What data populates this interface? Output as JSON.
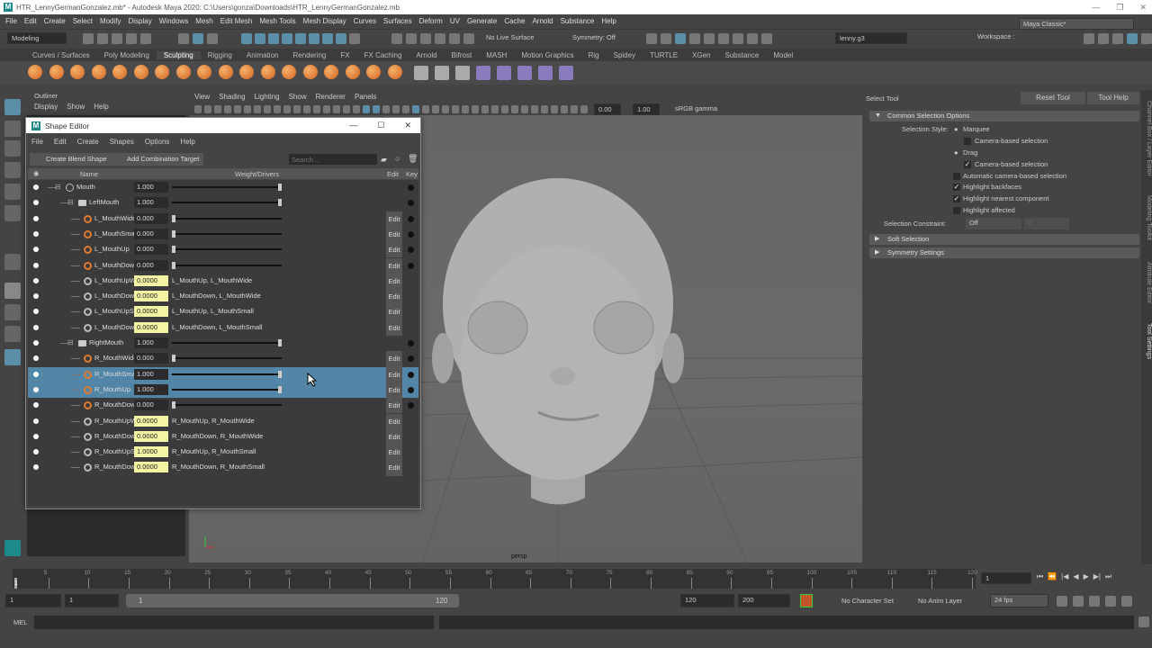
{
  "title": "HTR_LennyGermanGonzalez.mb* - Autodesk Maya 2020: C:\\Users\\gonza\\Downloads\\HTR_LennyGermanGonzalez.mb",
  "menus": [
    "File",
    "Edit",
    "Create",
    "Select",
    "Modify",
    "Display",
    "Windows",
    "Mesh",
    "Edit Mesh",
    "Mesh Tools",
    "Mesh Display",
    "Curves",
    "Surfaces",
    "Deform",
    "UV",
    "Generate",
    "Cache",
    "Arnold",
    "Substance",
    "Help"
  ],
  "workspace": {
    "label": "Workspace :",
    "value": "Maya Classic*"
  },
  "status": {
    "mode": "Modeling",
    "live_surface": "No Live Surface",
    "symmetry": "Symmetry: Off",
    "user": "lenny.g3"
  },
  "shelf_tabs": [
    "Curves / Surfaces",
    "Poly Modeling",
    "Sculpting",
    "Rigging",
    "Animation",
    "Rendering",
    "FX",
    "FX Caching",
    "Arnold",
    "Bifrost",
    "MASH",
    "Motion Graphics",
    "Rig",
    "Spidey",
    "TURTLE",
    "XGen",
    "Substance",
    "Model"
  ],
  "shelf_active": "Sculpting",
  "outliner": {
    "title": "Outliner",
    "menus": [
      "Display",
      "Show",
      "Help"
    ]
  },
  "viewport": {
    "menus": [
      "View",
      "Shading",
      "Lighting",
      "Show",
      "Renderer",
      "Panels"
    ],
    "exposure": "0.00",
    "gamma": "1.00",
    "color_space": "sRGB gamma",
    "camera": "persp"
  },
  "shape_editor": {
    "title": "Shape Editor",
    "menus": [
      "File",
      "Edit",
      "Create",
      "Shapes",
      "Options",
      "Help"
    ],
    "create_blend_shape": "Create Blend Shape",
    "add_combination": "Add Combination Target",
    "search_placeholder": "Search...",
    "columns": {
      "name": "Name",
      "weight": "Weight/Drivers",
      "edit": "Edit",
      "key": "Key"
    },
    "rows": [
      {
        "name": "Mouth",
        "value": "1.000",
        "kind": "slider",
        "weight": 1,
        "level": 0,
        "icon": "blendshape",
        "key": true
      },
      {
        "name": "LeftMouth",
        "value": "1.000",
        "kind": "slider",
        "weight": 1,
        "level": 1,
        "icon": "folder",
        "key": true
      },
      {
        "name": "L_MouthWide",
        "value": "0.000",
        "kind": "slider",
        "weight": 0,
        "level": 2,
        "icon": "target",
        "edit": "Edit",
        "key": true
      },
      {
        "name": "L_MouthSmall",
        "value": "0.000",
        "kind": "slider",
        "weight": 0,
        "level": 2,
        "icon": "target",
        "edit": "Edit",
        "key": true
      },
      {
        "name": "L_MouthUp",
        "value": "0.000",
        "kind": "slider",
        "weight": 0,
        "level": 2,
        "icon": "target",
        "edit": "Edit",
        "key": true
      },
      {
        "name": "L_MouthDown",
        "value": "0.000",
        "kind": "slider",
        "weight": 0,
        "level": 2,
        "icon": "target",
        "edit": "Edit",
        "key": true
      },
      {
        "name": "L_MouthUpWide",
        "value": "0.0000",
        "kind": "combo",
        "drivers": "L_MouthUp, L_MouthWide",
        "level": 2,
        "icon": "combo",
        "edit": "Edit"
      },
      {
        "name": "L_MouthDownWide",
        "value": "0.0000",
        "kind": "combo",
        "drivers": "L_MouthDown, L_MouthWide",
        "level": 2,
        "icon": "combo",
        "edit": "Edit"
      },
      {
        "name": "L_MouthUpSmall",
        "value": "0.0000",
        "kind": "combo",
        "drivers": "L_MouthUp, L_MouthSmall",
        "level": 2,
        "icon": "combo",
        "edit": "Edit"
      },
      {
        "name": "L_MouthDownSmall",
        "value": "0.0000",
        "kind": "combo",
        "drivers": "L_MouthDown, L_MouthSmall",
        "level": 2,
        "icon": "combo",
        "edit": "Edit"
      },
      {
        "name": "RightMouth",
        "value": "1.000",
        "kind": "slider",
        "weight": 1,
        "level": 1,
        "icon": "folder",
        "key": true
      },
      {
        "name": "R_MouthWide",
        "value": "0.000",
        "kind": "slider",
        "weight": 0,
        "level": 2,
        "icon": "target",
        "edit": "Edit",
        "key": true
      },
      {
        "name": "R_MouthSmall",
        "value": "1.000",
        "kind": "slider",
        "weight": 1,
        "level": 2,
        "icon": "target",
        "edit": "Edit",
        "key": true,
        "selected": true
      },
      {
        "name": "R_MouthUp",
        "value": "1.000",
        "kind": "slider",
        "weight": 1,
        "level": 2,
        "icon": "target",
        "edit": "Edit",
        "key": true,
        "selected": true
      },
      {
        "name": "R_MouthDown",
        "value": "0.000",
        "kind": "slider",
        "weight": 0,
        "level": 2,
        "icon": "target",
        "edit": "Edit",
        "key": true
      },
      {
        "name": "R_MouthUpWide",
        "value": "0.0000",
        "kind": "combo",
        "drivers": "R_MouthUp, R_MouthWide",
        "level": 2,
        "icon": "combo",
        "edit": "Edit"
      },
      {
        "name": "R_MouthDownWide",
        "value": "0.0000",
        "kind": "combo",
        "drivers": "R_MouthDown, R_MouthWide",
        "level": 2,
        "icon": "combo",
        "edit": "Edit"
      },
      {
        "name": "R_MouthUpSmall",
        "value": "1.0000",
        "kind": "combo",
        "drivers": "R_MouthUp, R_MouthSmall",
        "level": 2,
        "icon": "combo",
        "edit": "Edit"
      },
      {
        "name": "R_MouthDownSmall",
        "value": "0.0000",
        "kind": "combo",
        "drivers": "R_MouthDown, R_MouthSmall",
        "level": 2,
        "icon": "combo",
        "edit": "Edit"
      }
    ]
  },
  "tool_settings": {
    "title": "Select Tool",
    "reset": "Reset Tool",
    "help": "Tool Help",
    "section_common": "Common Selection Options",
    "selection_style_label": "Selection Style:",
    "marquee": "Marquee",
    "camera_based_1": "Camera-based selection",
    "drag": "Drag",
    "camera_based_2": "Camera-based selection",
    "auto_camera": "Automatic camera-based selection",
    "highlight_backfaces": "Highlight backfaces",
    "highlight_nearest": "Highlight nearest component",
    "highlight_affected": "Highlight affected",
    "constraint_label": "Selection Constraint:",
    "constraint_value": "Off",
    "constraint_num": "0",
    "section_soft": "Soft Selection",
    "section_symmetry": "Symmetry Settings"
  },
  "side_tabs": [
    "Channel Box / Layer Editor",
    "Modeling Toolkit",
    "Attribute Editor",
    "Tool Settings"
  ],
  "timeline": {
    "start": 1,
    "end": 120,
    "step": 5,
    "current": "1"
  },
  "range": {
    "start": "1",
    "anim_start": "1",
    "slider_start": "1",
    "slider_end": "120",
    "end": "120",
    "anim_end": "200",
    "character_set": "No Character Set",
    "anim_layer": "No Anim Layer",
    "fps": "24 fps"
  },
  "command": {
    "lang": "MEL"
  },
  "colors": {
    "accent": "#5285a6",
    "shape_orange": "#e07a2c",
    "combo_field": "#f4f4a4"
  }
}
